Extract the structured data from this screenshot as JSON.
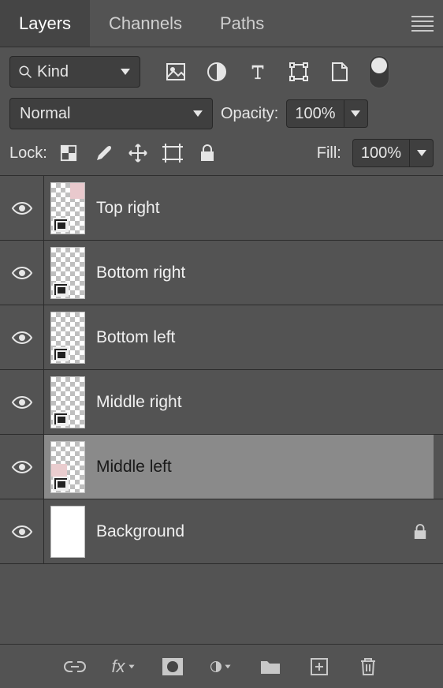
{
  "tabs": {
    "layers": "Layers",
    "channels": "Channels",
    "paths": "Paths",
    "active": "layers"
  },
  "filter": {
    "kind_label": "Kind"
  },
  "blend": {
    "mode": "Normal",
    "opacity_label": "Opacity:",
    "opacity_value": "100%"
  },
  "lock": {
    "label": "Lock:",
    "fill_label": "Fill:",
    "fill_value": "100%"
  },
  "layers": [
    {
      "name": "Top right",
      "smart_object": true,
      "thumb": "pink_tr",
      "selected": false,
      "locked": false
    },
    {
      "name": "Bottom right",
      "smart_object": true,
      "thumb": "trans",
      "selected": false,
      "locked": false
    },
    {
      "name": "Bottom left",
      "smart_object": true,
      "thumb": "trans",
      "selected": false,
      "locked": false
    },
    {
      "name": "Middle right",
      "smart_object": true,
      "thumb": "trans",
      "selected": false,
      "locked": false
    },
    {
      "name": "Middle left",
      "smart_object": true,
      "thumb": "pink_bl",
      "selected": true,
      "locked": false
    },
    {
      "name": "Background",
      "smart_object": false,
      "thumb": "white",
      "selected": false,
      "locked": true
    }
  ],
  "icons": {
    "search": "search-icon",
    "image": "image-icon",
    "adjust": "adjustment-icon",
    "type": "type-icon",
    "shape": "shape-icon",
    "smart": "smart-object-icon",
    "pixels": "lock-pixels-icon",
    "brush": "lock-brush-icon",
    "move": "lock-move-icon",
    "artboard": "lock-artboard-icon",
    "lockall": "lock-all-icon",
    "eye": "visibility-icon",
    "link": "link-icon",
    "fx": "fx-icon",
    "mask": "mask-icon",
    "adj": "adjustment-layer-icon",
    "group": "group-icon",
    "new": "new-layer-icon",
    "trash": "trash-icon"
  }
}
